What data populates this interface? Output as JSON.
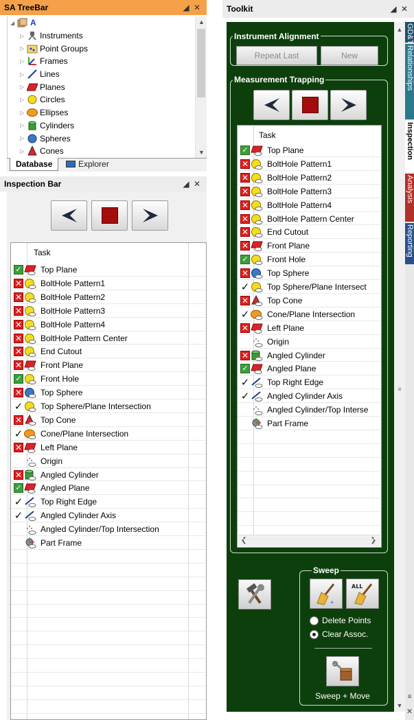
{
  "treebar": {
    "title": "SA TreeBar",
    "pin_icon": "pin-icon",
    "close_icon": "close-icon",
    "root_label": "A",
    "items": [
      {
        "label": "Instruments",
        "icon": "instrument-icon"
      },
      {
        "label": "Point Groups",
        "icon": "point-groups-icon"
      },
      {
        "label": "Frames",
        "icon": "frame-icon"
      },
      {
        "label": "Lines",
        "icon": "line-icon"
      },
      {
        "label": "Planes",
        "icon": "plane-icon"
      },
      {
        "label": "Circles",
        "icon": "circle-icon"
      },
      {
        "label": "Ellipses",
        "icon": "ellipse-icon"
      },
      {
        "label": "Cylinders",
        "icon": "cylinder-icon"
      },
      {
        "label": "Spheres",
        "icon": "sphere-icon"
      },
      {
        "label": "Cones",
        "icon": "cone-icon"
      }
    ],
    "tabs": {
      "database": "Database",
      "explorer": "Explorer"
    }
  },
  "inspection_bar": {
    "title": "Inspection Bar",
    "column_header": "Task"
  },
  "tasks": [
    {
      "label": "Top Plane",
      "status": "done",
      "icon": "plane"
    },
    {
      "label": "BoltHole Pattern1",
      "status": "fail",
      "icon": "circle"
    },
    {
      "label": "BoltHole Pattern2",
      "status": "fail",
      "icon": "circle"
    },
    {
      "label": "BoltHole Pattern3",
      "status": "fail",
      "icon": "circle"
    },
    {
      "label": "BoltHole Pattern4",
      "status": "fail",
      "icon": "circle"
    },
    {
      "label": "BoltHole Pattern Center",
      "status": "fail",
      "icon": "circle"
    },
    {
      "label": "End Cutout",
      "status": "fail",
      "icon": "circle"
    },
    {
      "label": "Front Plane",
      "status": "fail",
      "icon": "plane"
    },
    {
      "label": "Front Hole",
      "status": "done",
      "icon": "circle"
    },
    {
      "label": "Top Sphere",
      "status": "fail",
      "icon": "sphere"
    },
    {
      "label": "Top Sphere/Plane Intersection",
      "status": "check",
      "icon": "circle"
    },
    {
      "label": "Top Cone",
      "status": "fail",
      "icon": "cone"
    },
    {
      "label": "Cone/Plane Intersection",
      "status": "check",
      "icon": "ellipse"
    },
    {
      "label": "Left Plane",
      "status": "fail",
      "icon": "plane"
    },
    {
      "label": "Origin",
      "status": "none",
      "icon": "point"
    },
    {
      "label": "Angled Cylinder",
      "status": "fail",
      "icon": "cylinder"
    },
    {
      "label": "Angled Plane",
      "status": "done",
      "icon": "plane"
    },
    {
      "label": "Top Right Edge",
      "status": "check",
      "icon": "line"
    },
    {
      "label": "Angled Cylinder Axis",
      "status": "check",
      "icon": "line"
    },
    {
      "label": "Angled Cylinder/Top Intersection",
      "status": "none",
      "icon": "point"
    },
    {
      "label": "Part Frame",
      "status": "none",
      "icon": "frame"
    }
  ],
  "toolkit": {
    "title": "Toolkit",
    "instrument_alignment": {
      "label": "Instrument Alignment",
      "repeat_last": "Repeat Last",
      "new": "New"
    },
    "measurement_trapping": {
      "label": "Measurement Trapping",
      "column_header": "Task",
      "right_tasks": [
        "Top Plane",
        "BoltHole Pattern1",
        "BoltHole Pattern2",
        "BoltHole Pattern3",
        "BoltHole Pattern4",
        "BoltHole Pattern Center",
        "End Cutout",
        "Front Plane",
        "Front Hole",
        "Top Sphere",
        "Top Sphere/Plane Intersect",
        "Top Cone",
        "Cone/Plane Intersection",
        "Left Plane",
        "Origin",
        "Angled Cylinder",
        "Angled Plane",
        "Top Right Edge",
        "Angled Cylinder Axis",
        "Angled Cylinder/Top Interse",
        "Part Frame"
      ]
    },
    "sweep": {
      "label": "Sweep",
      "all_label": "ALL",
      "delete_points": "Delete Points",
      "clear_assoc": "Clear Assoc.",
      "selected": "clear_assoc",
      "sweep_move": "Sweep + Move"
    },
    "side_tabs": [
      {
        "label": "GD&T",
        "color": "#1e4f6a"
      },
      {
        "label": "Relationships",
        "color": "#2a7a8c"
      },
      {
        "label": "Inspection",
        "color": "#0e3d10"
      },
      {
        "label": "Analysis",
        "color": "#b0302a"
      },
      {
        "label": "Reporting",
        "color": "#2a4f8c"
      }
    ]
  },
  "colors": {
    "treebar_title": "#f5a14a",
    "toolkit_green": "#0d3f0d",
    "fail_red": "#e01f1f",
    "done_green": "#3d9e3d",
    "stop_red": "#a30d0d"
  }
}
